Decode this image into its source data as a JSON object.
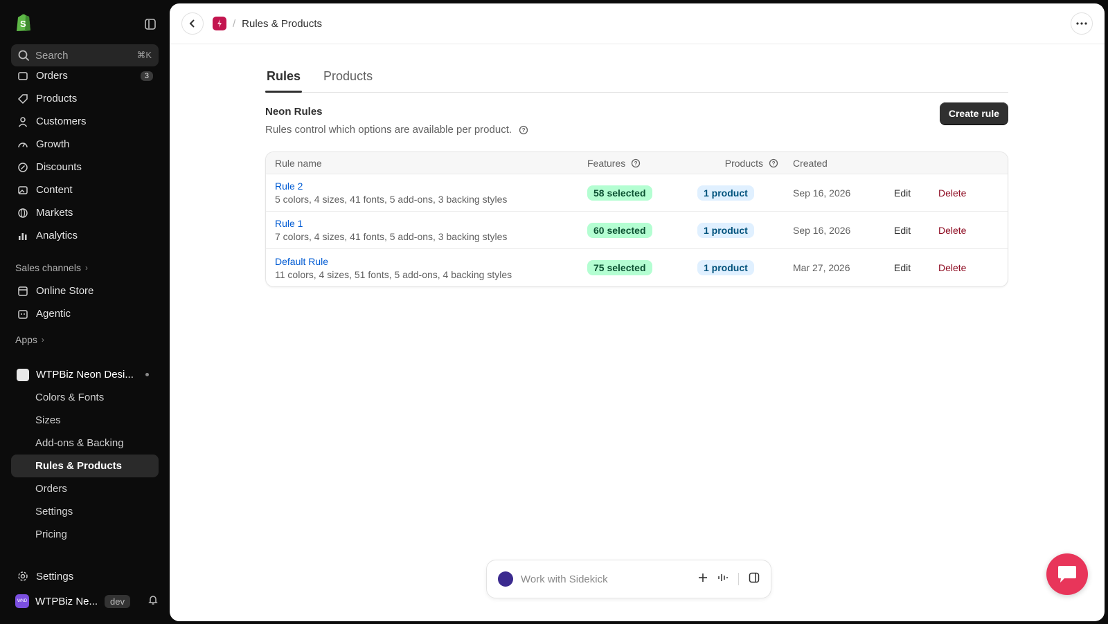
{
  "sidebar": {
    "search_placeholder": "Search",
    "search_shortcut": "⌘K",
    "nav": [
      {
        "label": "Orders",
        "badge": "3"
      },
      {
        "label": "Products"
      },
      {
        "label": "Customers"
      },
      {
        "label": "Growth"
      },
      {
        "label": "Discounts"
      },
      {
        "label": "Content"
      },
      {
        "label": "Markets"
      },
      {
        "label": "Analytics"
      }
    ],
    "sales_channels_label": "Sales channels",
    "channels": [
      {
        "label": "Online Store"
      },
      {
        "label": "Agentic"
      }
    ],
    "apps_label": "Apps",
    "app_name": "WTPBiz Neon Desi...",
    "app_subitems": [
      {
        "label": "Colors & Fonts"
      },
      {
        "label": "Sizes"
      },
      {
        "label": "Add-ons & Backing"
      },
      {
        "label": "Rules & Products"
      },
      {
        "label": "Orders"
      },
      {
        "label": "Settings"
      },
      {
        "label": "Pricing"
      }
    ],
    "settings_label": "Settings",
    "store_name": "WTPBiz Ne...",
    "store_tag": "dev",
    "store_avatar_text": "WND"
  },
  "topbar": {
    "breadcrumb": "Rules & Products"
  },
  "tabs": [
    {
      "label": "Rules",
      "active": true
    },
    {
      "label": "Products",
      "active": false
    }
  ],
  "section": {
    "title": "Neon Rules",
    "subtitle": "Rules control which options are available per product.",
    "create_label": "Create rule"
  },
  "table": {
    "headers": {
      "name": "Rule name",
      "features": "Features",
      "products": "Products",
      "created": "Created"
    },
    "rows": [
      {
        "name": "Rule 2",
        "desc": "5 colors, 4 sizes, 41 fonts, 5 add-ons, 3 backing styles",
        "features": "58 selected",
        "products": "1 product",
        "created": "Sep 16, 2026",
        "edit": "Edit",
        "delete": "Delete"
      },
      {
        "name": "Rule 1",
        "desc": "7 colors, 4 sizes, 41 fonts, 5 add-ons, 3 backing styles",
        "features": "60 selected",
        "products": "1 product",
        "created": "Sep 16, 2026",
        "edit": "Edit",
        "delete": "Delete"
      },
      {
        "name": "Default Rule",
        "desc": "11 colors, 4 sizes, 51 fonts, 5 add-ons, 4 backing styles",
        "features": "75 selected",
        "products": "1 product",
        "created": "Mar 27, 2026",
        "edit": "Edit",
        "delete": "Delete"
      }
    ]
  },
  "sidekick": {
    "placeholder": "Work with Sidekick"
  },
  "colors": {
    "accent_link": "#005bd3",
    "delete": "#8e0b21",
    "pill_green": "#b4fed2",
    "pill_blue": "#e0f0ff",
    "app_tile": "#c3154f",
    "chat_fab": "#e8355a"
  }
}
